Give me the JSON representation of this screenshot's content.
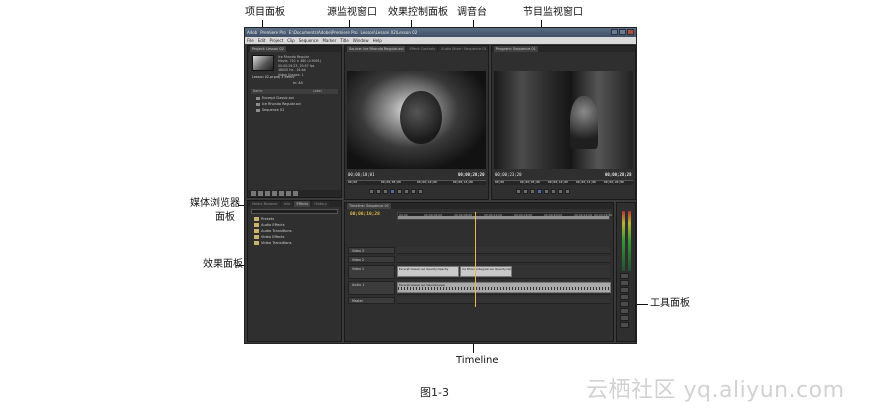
{
  "callouts": {
    "project_panel": "项目面板",
    "source_monitor": "源监视窗口",
    "effect_controls": "效果控制面板",
    "audio_mixer": "调音台",
    "program_monitor": "节目监视窗口",
    "media_browser_line1": "媒体浏览器",
    "media_browser_line2": "面板",
    "effects_panel": "效果面板",
    "tools_panel": "工具面板",
    "timeline": "Timeline"
  },
  "figure_caption": "图1-3",
  "watermark": "云栖社区 yq.aliyun.com",
  "app": {
    "title_parts": [
      "Adob",
      "Premiere Pro",
      "E:\\Documents\\Adobe\\Premiere Pro",
      "Lesson\\Lesson 02\\Lesson 02"
    ],
    "menu": [
      "File",
      "Edit",
      "Project",
      "Clip",
      "Sequence",
      "Marker",
      "Title",
      "Window",
      "Help"
    ],
    "project": {
      "tab": "Project: Lesson 02",
      "clip_name": "Ice Rhonda Regular",
      "meta": [
        "Movie, 720 × 480 (0.9091)",
        "00:00:29:23, 29.97 fps",
        "48000 Hz - 16-bit",
        "Video Usages: 1"
      ],
      "summary": "Lesson 02.prproj   3 Items",
      "in_label": "In:   All",
      "columns": [
        "Name",
        "Label"
      ],
      "items": [
        "Excerpt Classic.avi",
        "Ice Rhonda Regular.avi",
        "Sequence 01"
      ]
    },
    "effects": {
      "tabs": [
        "Media Browser",
        "Info",
        "Effects",
        "History"
      ],
      "items": [
        "Presets",
        "Audio Effects",
        "Audio Transitions",
        "Video Effects",
        "Video Transitions"
      ]
    },
    "source": {
      "tabs": [
        "Source: Ice Rhonda Regular.avi",
        "Effect Controls",
        "Audio Mixer: Sequence 01"
      ],
      "timecode_left": "00;00;10;01",
      "timecode_right": "00;00;20;20",
      "ruler_marks": [
        "00;00",
        "00;00;05;00",
        "00;00;10;00",
        "00;00;15;00"
      ]
    },
    "program": {
      "tab": "Program: Sequence 01",
      "timecode_left": "00;00;23;20",
      "timecode_right": "00;00;28;28",
      "ruler_marks": [
        "00;00",
        "00;00;05;00",
        "00;00;10;00",
        "00;00;15;00",
        "00;00;20;00"
      ]
    },
    "timeline": {
      "tab": "Timeline: Sequence 01",
      "timecode": "00;00;10;28",
      "ruler": [
        "00;00",
        "00;00;04;00",
        "00;00;08;00",
        "00;00;12;00",
        "00;00;16;00",
        "00;00;20;00",
        "00;00;24;00",
        "00;00;28;00"
      ],
      "tracks": [
        "Video 3",
        "Video 2",
        "Video 1",
        "Audio 1",
        "Master"
      ],
      "video_clip": "Excerpt Classic.avi  Opacity:Opacity",
      "video_clip2": "Ice Rhonda Regular.avi  Opacity:Opacity",
      "audio_clip": "Excerpt Classic.avi  Volume:Level"
    }
  }
}
